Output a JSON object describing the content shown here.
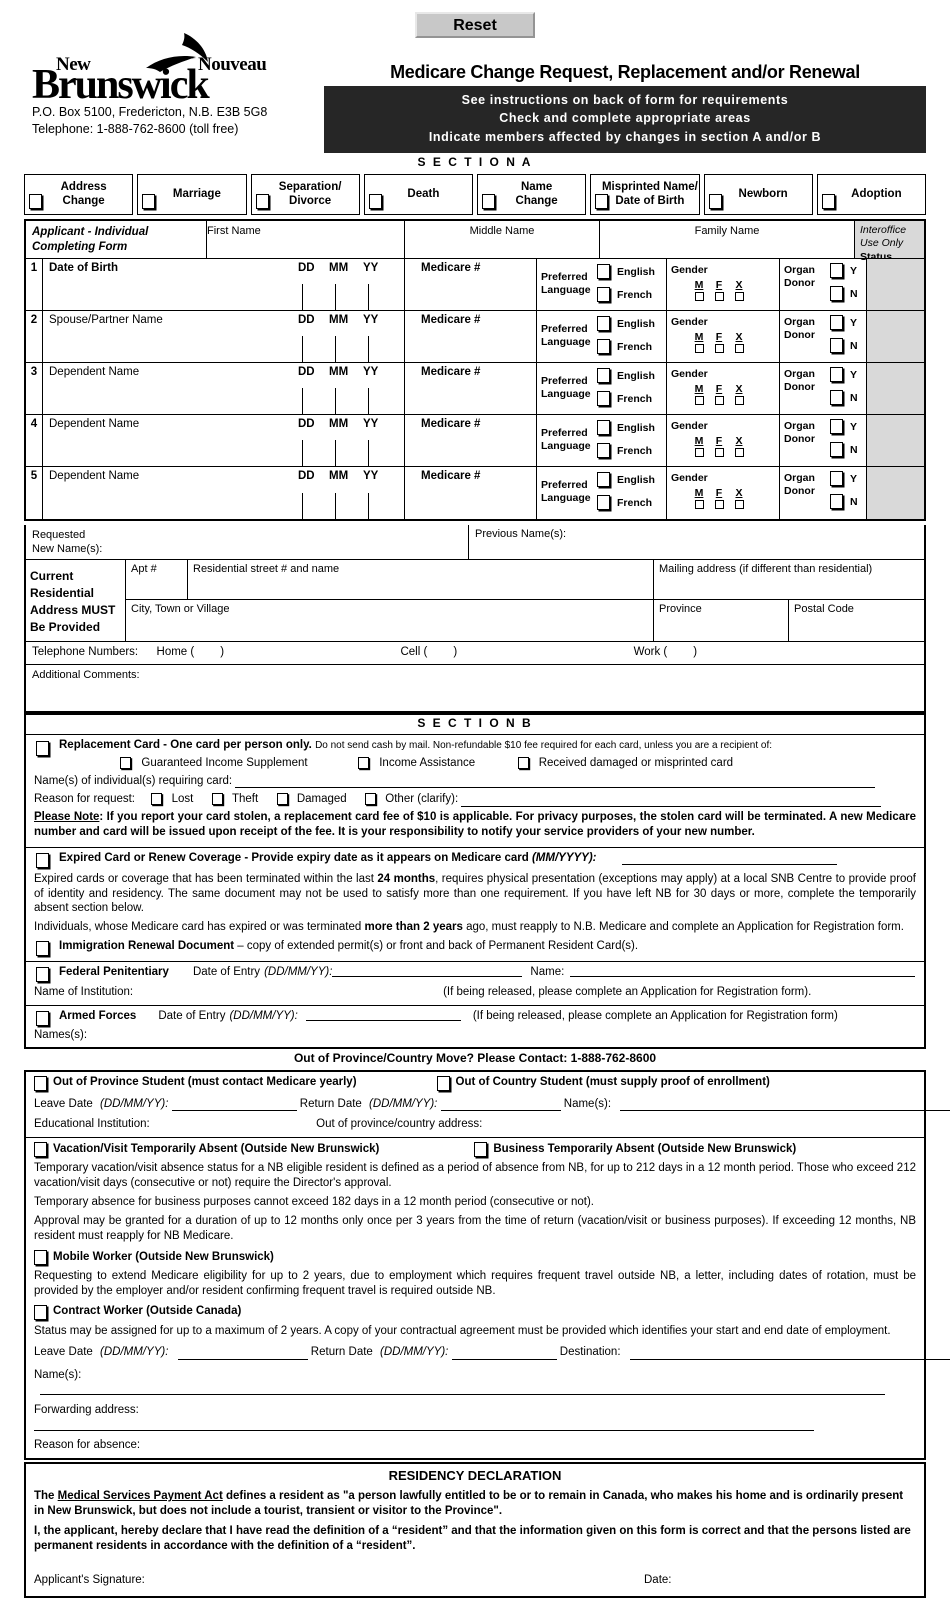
{
  "header": {
    "reset_label": "Reset",
    "logo_new": "New",
    "logo_nouveau": "Nouveau",
    "logo_brunswick": "Brunswick",
    "address_line1": "P.O. Box 5100, Fredericton, N.B.  E3B 5G8",
    "address_line2": "Telephone:  1-888-762-8600 (toll free)",
    "form_title": "Medicare Change Request, Replacement and/or Renewal",
    "band_line1": "See instructions on back of form for requirements",
    "band_line2": "Check and complete appropriate areas",
    "band_line3": "Indicate members affected by changes in section A and/or B",
    "section_a_label": "S E C T I O N   A"
  },
  "reasons": [
    {
      "line1": "Address",
      "line2": "Change"
    },
    {
      "line1": "Marriage",
      "line2": ""
    },
    {
      "line1": "Separation/",
      "line2": "Divorce"
    },
    {
      "line1": "Death",
      "line2": ""
    },
    {
      "line1": "Name",
      "line2": "Change"
    },
    {
      "line1": "Misprinted Name/",
      "line2": "Date of Birth"
    },
    {
      "line1": "Newborn",
      "line2": ""
    },
    {
      "line1": "Adoption",
      "line2": ""
    }
  ],
  "table": {
    "applicant_label_l1": "Applicant - Individual",
    "applicant_label_l2": "Completing Form",
    "col_first": "First Name",
    "col_middle": "Middle Name",
    "col_family": "Family Name",
    "interoffice_l1": "Interoffice",
    "interoffice_l2": "Use Only",
    "interoffice_l3": "Status",
    "dd": "DD",
    "mm": "MM",
    "yy": "YY",
    "medicare": "Medicare #",
    "preferred_language_l1": "Preferred",
    "preferred_language_l2": "Language",
    "english": "English",
    "french": "French",
    "gender": "Gender",
    "gender_options": [
      "M",
      "F",
      "X"
    ],
    "organ_donor_l1": "Organ",
    "organ_donor_l2": "Donor",
    "yes": "Y",
    "no": "N",
    "rows": [
      {
        "num": "1",
        "label": "Date of Birth",
        "bold": true
      },
      {
        "num": "2",
        "label": "Spouse/Partner Name",
        "bold": false
      },
      {
        "num": "3",
        "label": "Dependent Name",
        "bold": false
      },
      {
        "num": "4",
        "label": "Dependent Name",
        "bold": false
      },
      {
        "num": "5",
        "label": "Dependent Name",
        "bold": false
      }
    ]
  },
  "names": {
    "requested_l1": "Requested",
    "requested_l2": "New Name(s):",
    "previous": "Previous Name(s):"
  },
  "address": {
    "side_l1": "Current",
    "side_l2": "Residential",
    "side_l3": "Address MUST",
    "side_l4": "Be Provided",
    "apt": "Apt #",
    "street": "Residential street # and name",
    "mailing": "Mailing address (if different than residential)",
    "city": "City, Town or Village",
    "province": "Province",
    "postal": "Postal Code",
    "telephone_label": "Telephone Numbers:",
    "home": "Home (",
    "cell": "Cell (",
    "work": "Work (",
    "paren_close": ")",
    "comments": "Additional Comments:"
  },
  "section_b": {
    "label": "S E C T I O N   B",
    "replacement": {
      "title": "Replacement Card - One card per person only.",
      "note": "Do not send cash by mail. Non-refundable $10 fee required for each card, unless you are a recipient of:",
      "opt1": "Guaranteed Income Supplement",
      "opt2": "Income Assistance",
      "opt3": "Received damaged or misprinted card",
      "names_label": "Name(s) of individual(s) requiring card:",
      "reason_label": "Reason for request:",
      "reason_lost": "Lost",
      "reason_theft": "Theft",
      "reason_damaged": "Damaged",
      "reason_other": "Other (clarify):",
      "please_note_label": "Please Note",
      "please_note_text": ":  If you report your card stolen, a replacement card fee of $10 is applicable.  For privacy purposes, the stolen card will be terminated.  A new Medicare number and card will be issued upon receipt of the fee.  It is your responsibility to notify your service providers of your new number."
    },
    "expired": {
      "title": "Expired Card or Renew Coverage - Provide expiry date as it appears on Medicare card",
      "title_format": "(MM/YYYY):",
      "para1_a": "Expired cards or coverage that has been terminated within the last ",
      "para1_bold": "24 months",
      "para1_b": ", requires physical presentation (exceptions may apply) at a local SNB Centre to provide proof of identity and residency. The same document may not be used to satisfy more than one requirement. If you have left NB for 30 days or more, complete the temporarily absent section below.",
      "para2_a": "Individuals, whose Medicare card has expired or was terminated ",
      "para2_bold": "more than 2 years",
      "para2_b": " ago, must reapply to N.B. Medicare and complete an Application for Registration form.",
      "immigration_title": "Immigration Renewal Document",
      "immigration_text": " –  copy of extended permit(s) or front and back of Permanent Resident Card(s)."
    },
    "federal": {
      "title": "Federal Penitentiary",
      "date_of_entry": "Date of Entry",
      "date_format": "(DD/MM/YY):",
      "name_label": "Name:",
      "institution_label": "Name of Institution:",
      "released_note": "(If being released, please complete an Application for Registration form)."
    },
    "armed": {
      "title": "Armed Forces",
      "date_of_entry": "Date of Entry",
      "date_format": "(DD/MM/YY):",
      "released_note": "(If being released, please complete an Application for Registration form)",
      "names_label": "Names(s):"
    },
    "move_contact": "Out of Province/Country Move?  Please Contact:  1-888-762-8600"
  },
  "travel": {
    "student_prov": "Out of Province Student (must contact Medicare yearly)",
    "student_country": "Out of Country Student (must supply proof of enrollment)",
    "leave_date": "Leave Date",
    "return_date": "Return Date",
    "date_format": "(DD/MM/YY):",
    "names_label": "Name(s):",
    "institution_label": "Educational Institution:",
    "oop_address_label": "Out of province/country address:",
    "vacation_title": "Vacation/Visit Temporarily Absent (Outside New Brunswick)",
    "business_title": "Business Temporarily Absent (Outside New Brunswick)",
    "vac_para1": "Temporary vacation/visit absence status for a NB eligible resident is defined as a period of absence from NB, for up to 212 days in a 12 month period. Those who exceed 212 vacation/visit days (consecutive or not) require the Director's approval.",
    "vac_para2": "Temporary absence for business purposes cannot exceed 182 days in a 12 month period (consecutive or not).",
    "vac_para3": "Approval may be granted for a duration of up to 12 months only once per 3 years from the time of return (vacation/visit or business purposes). If exceeding 12 months, NB resident must reapply for NB Medicare.",
    "mobile_title": "Mobile Worker (Outside New Brunswick)",
    "mobile_text": "Requesting to extend Medicare eligibility for up to 2 years, due to employment which requires frequent travel outside NB, a letter, including dates of rotation, must be provided by the employer and/or resident confirming frequent travel is required outside NB.",
    "contract_title": "Contract Worker (Outside Canada)",
    "contract_text": "Status may be assigned for up to a maximum of 2 years. A copy of your contractual agreement must be provided which identifies your start and end date of employment.",
    "destination_label": "Destination:",
    "forwarding_label": "Forwarding address:",
    "reason_absence_label": "Reason for absence:"
  },
  "residency": {
    "title": "RESIDENCY DECLARATION",
    "p1_a": "The ",
    "p1_act": "Medical Services Payment Act",
    "p1_b": " defines a resident as \"a person lawfully entitled to be or to remain in Canada, who makes his home and is ordinarily present in New Brunswick, but does not include a tourist, transient or visitor to the Province\".",
    "p2": "I, the applicant, hereby declare that I have read the definition of a “resident” and that the information given on this form is correct and that the persons listed are permanent residents in accordance with the definition of a “resident”.",
    "signature_label": "Applicant's Signature:",
    "date_label": "Date:"
  }
}
